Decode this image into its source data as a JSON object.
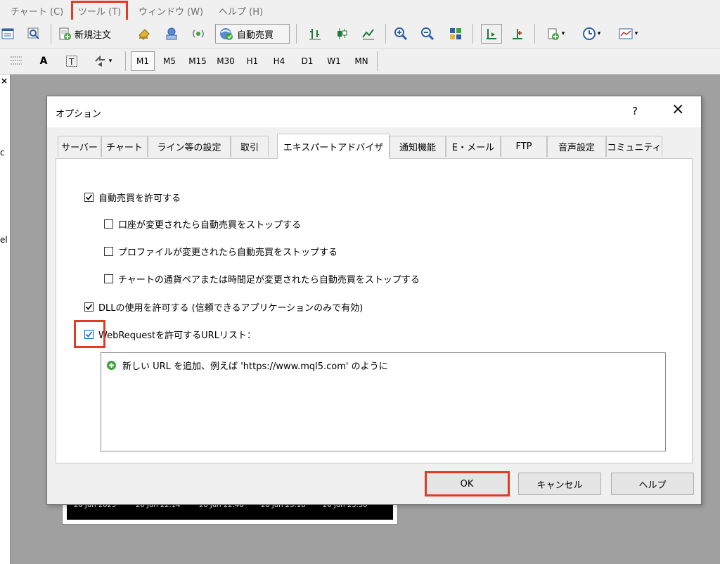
{
  "menu": {
    "items": [
      "チャート (C)",
      "ツール (T)",
      "ウィンドウ (W)",
      "ヘルプ (H)"
    ]
  },
  "toolbar": {
    "new_order": "新規注文",
    "auto_trading": "自動売買",
    "timeframes": [
      "M1",
      "M5",
      "M15",
      "M30",
      "H1",
      "H4",
      "D1",
      "W1",
      "MN"
    ],
    "text_tool": "A"
  },
  "left_strip": {
    "close_glyph": "×",
    "fragment1": "c",
    "fragment2": "el"
  },
  "dialog": {
    "title": "オプション",
    "help_glyph": "?",
    "close_glyph": "×",
    "tabs": [
      "サーバー",
      "チャート",
      "ライン等の設定",
      "取引",
      "エキスパートアドバイザ",
      "通知機能",
      "E・メール",
      "FTP",
      "音声設定",
      "コミュニティ"
    ],
    "active_tab_index": 4,
    "options": {
      "allow_auto_trading": {
        "label": "自動売買を許可する",
        "checked": true
      },
      "stop_on_account_change": {
        "label": "口座が変更されたら自動売買をストップする",
        "checked": false
      },
      "stop_on_profile_change": {
        "label": "プロファイルが変更されたら自動売買をストップする",
        "checked": false
      },
      "stop_on_symbol_change": {
        "label": "チャートの通貨ペアまたは時間足が変更されたら自動売買をストップする",
        "checked": false
      },
      "allow_dll": {
        "label": "DLLの使用を許可する (信頼できるアプリケーションのみで有効)",
        "checked": true
      },
      "allow_webrequest": {
        "label": "WebRequestを許可するURLリスト：",
        "checked": true
      }
    },
    "url_list": {
      "add_hint": "新しい URL を追加、例えば 'https://www.mql5.com' のように"
    },
    "buttons": {
      "ok": "OK",
      "cancel": "キャンセル",
      "help": "ヘルプ"
    }
  },
  "chart_remnant": {
    "time_labels": [
      "20 Jun 2025",
      "20 Jun 22:14",
      "20 Jun 22:46",
      "20 Jun 23:18",
      "20 Jun 23:50"
    ]
  },
  "colors": {
    "highlight": "#e03b24",
    "checkmark": "#000000",
    "add_icon": "#3aa63a",
    "default_button_border": "#0078d7"
  }
}
